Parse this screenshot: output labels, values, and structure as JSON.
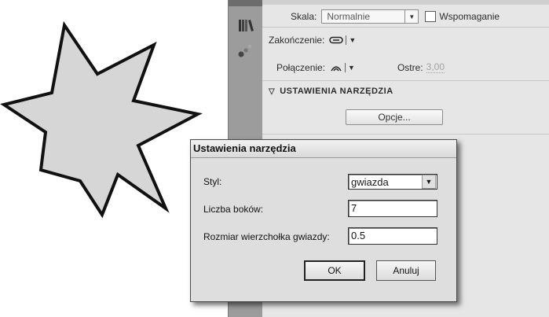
{
  "panel": {
    "skala_label": "Skala:",
    "skala_value": "Normalnie",
    "wspomaganie_label": "Wspomaganie",
    "zakonczenie_label": "Zakończenie:",
    "polaczenie_label": "Połączenie:",
    "ostre_label": "Ostre:",
    "ostre_value": "3,00",
    "section_title": "USTAWIENIA NARZĘDZIA",
    "opcje_label": "Opcje..."
  },
  "dialog": {
    "title": "Ustawienia narzędzia",
    "styl_label": "Styl:",
    "styl_value": "gwiazda",
    "liczba_label": "Liczba boków:",
    "liczba_value": "7",
    "rozmiar_label": "Rozmiar wierzchołka gwiazdy:",
    "rozmiar_value": "0.5",
    "ok_label": "OK",
    "cancel_label": "Anuluj"
  },
  "icons": {
    "library": "library-icon",
    "motion": "motion-presets-icon",
    "cap": "cap-round-icon",
    "join": "join-round-icon"
  },
  "colors": {
    "star_fill": "#d6d6d6",
    "star_stroke": "#111111",
    "dock": "#9c9c9c",
    "panel": "#e6e6e6"
  }
}
